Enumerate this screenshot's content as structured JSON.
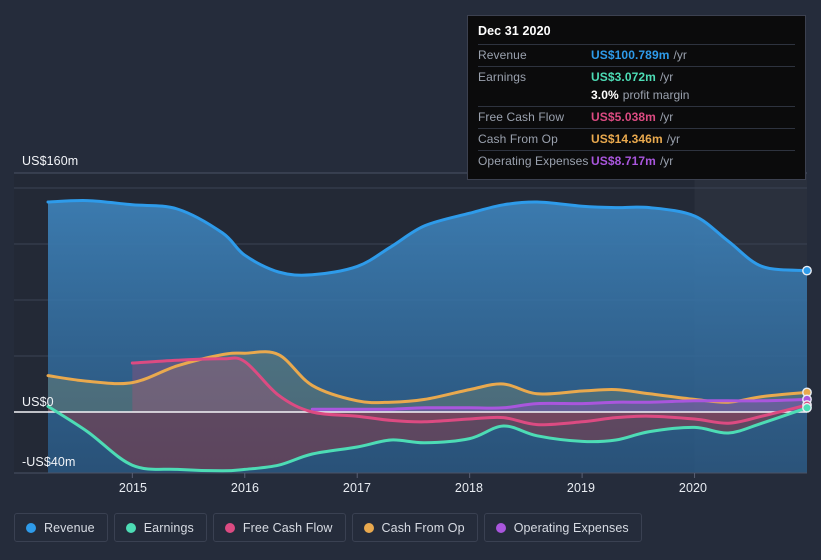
{
  "tooltip": {
    "date": "Dec 31 2020",
    "rows": [
      {
        "label": "Revenue",
        "value": "US$100.789m",
        "unit": "/yr",
        "color": "#2e9bea",
        "sub": ""
      },
      {
        "label": "Earnings",
        "value": "US$3.072m",
        "unit": "/yr",
        "color": "#4ddcb5",
        "sub": ""
      },
      {
        "label": "",
        "value": "3.0%",
        "unit": "",
        "color": "#ffffff",
        "sub": "profit margin"
      },
      {
        "label": "Free Cash Flow",
        "value": "US$5.038m",
        "unit": "/yr",
        "color": "#dc4b82",
        "sub": ""
      },
      {
        "label": "Cash From Op",
        "value": "US$14.346m",
        "unit": "/yr",
        "color": "#e9a94e",
        "sub": ""
      },
      {
        "label": "Operating Expenses",
        "value": "US$8.717m",
        "unit": "/yr",
        "color": "#a956dd",
        "sub": ""
      }
    ]
  },
  "legend": {
    "items": [
      {
        "label": "Revenue",
        "color": "#2e9bea"
      },
      {
        "label": "Earnings",
        "color": "#4ddcb5"
      },
      {
        "label": "Free Cash Flow",
        "color": "#dc4b82"
      },
      {
        "label": "Cash From Op",
        "color": "#e9a94e"
      },
      {
        "label": "Operating Expenses",
        "color": "#a956dd"
      }
    ]
  },
  "chart_data": {
    "type": "area",
    "title": "",
    "xlabel": "",
    "ylabel": "",
    "currency": "US$",
    "units": "m",
    "ylim": [
      -40,
      160
    ],
    "grid": true,
    "legend_position": "bottom",
    "y_ticks": [
      {
        "label": "US$160m",
        "value": 160
      },
      {
        "label": "US$0",
        "value": 0
      },
      {
        "label": "-US$40m",
        "value": -40
      }
    ],
    "x_ticks": [
      {
        "label": "2015",
        "value": 2015
      },
      {
        "label": "2016",
        "value": 2016
      },
      {
        "label": "2017",
        "value": 2017
      },
      {
        "label": "2018",
        "value": 2018
      },
      {
        "label": "2019",
        "value": 2019
      },
      {
        "label": "2020",
        "value": 2020
      }
    ],
    "x_range": [
      2014.25,
      2021.0
    ],
    "highlight_band": {
      "from": 2020.0,
      "to": 2021.0
    },
    "series": [
      {
        "name": "Revenue",
        "color": "#2e9bea",
        "x": [
          2014.25,
          2014.6,
          2015.0,
          2015.4,
          2015.8,
          2016.0,
          2016.3,
          2016.6,
          2017.0,
          2017.3,
          2017.6,
          2018.0,
          2018.3,
          2018.6,
          2019.0,
          2019.3,
          2019.6,
          2020.0,
          2020.3,
          2020.6,
          2021.0
        ],
        "values": [
          150,
          151,
          148,
          145,
          128,
          112,
          100,
          98,
          104,
          118,
          133,
          142,
          148,
          150,
          147,
          146,
          146,
          140,
          122,
          104,
          101
        ]
      },
      {
        "name": "Earnings",
        "color": "#4ddcb5",
        "x": [
          2014.25,
          2014.6,
          2015.0,
          2015.4,
          2015.8,
          2016.0,
          2016.3,
          2016.6,
          2017.0,
          2017.3,
          2017.6,
          2018.0,
          2018.3,
          2018.6,
          2019.0,
          2019.3,
          2019.6,
          2020.0,
          2020.3,
          2020.6,
          2021.0
        ],
        "values": [
          4,
          -14,
          -38,
          -41,
          -42,
          -41,
          -38,
          -30,
          -25,
          -20,
          -22,
          -19,
          -10,
          -17,
          -21,
          -20,
          -14,
          -11,
          -15,
          -8,
          3
        ]
      },
      {
        "name": "Free Cash Flow",
        "color": "#dc4b82",
        "x": [
          2015.0,
          2015.4,
          2015.8,
          2016.0,
          2016.3,
          2016.6,
          2017.0,
          2017.3,
          2017.6,
          2018.0,
          2018.3,
          2018.6,
          2019.0,
          2019.3,
          2019.6,
          2020.0,
          2020.3,
          2020.6,
          2021.0
        ],
        "values": [
          35,
          37,
          38,
          36,
          12,
          0,
          -3,
          -6,
          -7,
          -5,
          -4,
          -9,
          -7,
          -4,
          -3,
          -5,
          -8,
          -3,
          5
        ]
      },
      {
        "name": "Cash From Op",
        "color": "#e9a94e",
        "x": [
          2014.25,
          2014.6,
          2015.0,
          2015.4,
          2015.8,
          2016.0,
          2016.3,
          2016.6,
          2017.0,
          2017.3,
          2017.6,
          2018.0,
          2018.3,
          2018.6,
          2019.0,
          2019.3,
          2019.6,
          2020.0,
          2020.3,
          2020.6,
          2021.0
        ],
        "values": [
          26,
          22,
          21,
          33,
          41,
          42,
          41,
          19,
          8,
          7,
          9,
          16,
          20,
          13,
          15,
          16,
          13,
          9,
          7,
          11,
          14
        ]
      },
      {
        "name": "Operating Expenses",
        "color": "#a956dd",
        "x": [
          2016.6,
          2017.0,
          2017.3,
          2017.6,
          2018.0,
          2018.3,
          2018.6,
          2019.0,
          2019.3,
          2019.6,
          2020.0,
          2020.3,
          2020.6,
          2021.0
        ],
        "values": [
          2,
          2,
          2,
          3,
          3,
          3,
          6,
          6,
          7,
          7,
          8,
          8,
          8,
          9
        ]
      }
    ]
  }
}
